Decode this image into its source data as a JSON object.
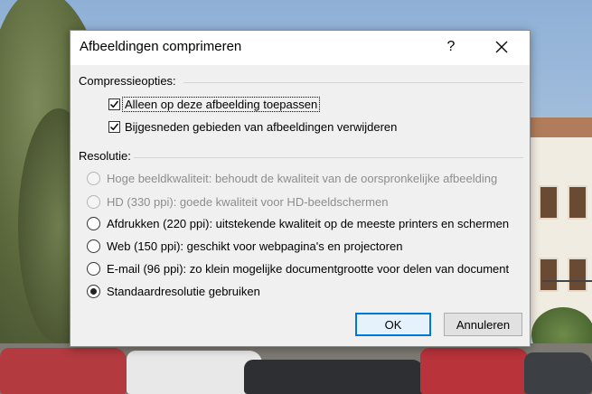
{
  "dialog": {
    "title": "Afbeeldingen comprimeren",
    "help_label": "?",
    "compression": {
      "heading": "Compressieopties:",
      "options": [
        {
          "label": "Alleen op deze afbeelding toepassen",
          "checked": true,
          "focused": true
        },
        {
          "label": "Bijgesneden gebieden van afbeeldingen verwijderen",
          "checked": true,
          "focused": false
        }
      ]
    },
    "resolution": {
      "heading": "Resolutie:",
      "options": [
        {
          "label": "Hoge beeldkwaliteit: behoudt de kwaliteit van de oorspronkelijke afbeelding",
          "selected": false,
          "enabled": false
        },
        {
          "label": "HD (330 ppi): goede kwaliteit voor HD-beeldschermen",
          "selected": false,
          "enabled": false
        },
        {
          "label": "Afdrukken (220 ppi): uitstekende kwaliteit op de meeste printers en schermen",
          "selected": false,
          "enabled": true
        },
        {
          "label": "Web (150 ppi): geschikt voor webpagina's en projectoren",
          "selected": false,
          "enabled": true
        },
        {
          "label": "E-mail (96 ppi): zo klein mogelijke documentgrootte voor delen van document",
          "selected": false,
          "enabled": true
        },
        {
          "label": "Standaardresolutie gebruiken",
          "selected": true,
          "enabled": true
        }
      ]
    },
    "buttons": {
      "ok": "OK",
      "cancel": "Annuleren"
    }
  },
  "colors": {
    "accent": "#0078d7",
    "dialog_bg": "#f0f0f0",
    "disabled_text": "#8d8d8d"
  }
}
